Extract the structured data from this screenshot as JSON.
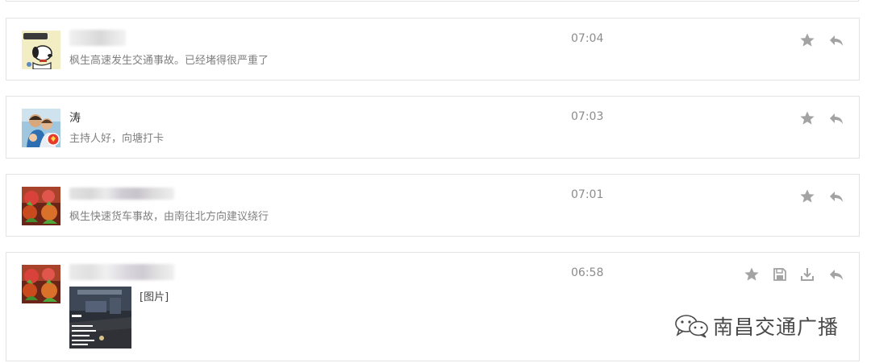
{
  "messages": [
    {
      "name": "",
      "time": "07:04",
      "text": "枫生高速发生交通事故。已经堵得很严重了"
    },
    {
      "name": "涛",
      "time": "07:03",
      "text": "主持人好，向塘打卡"
    },
    {
      "name": "",
      "time": "07:01",
      "text": "枫生快速货车事故，由南往北方向建议绕行"
    },
    {
      "name": "",
      "time": "06:58",
      "image_label": "[图片]"
    }
  ],
  "watermark": {
    "text": "南昌交通广播",
    "icon": "wechat-icon"
  },
  "icons": {
    "star": "star-icon",
    "reply": "reply-icon",
    "save": "save-icon",
    "download": "download-icon"
  },
  "colors": {
    "icon_gray": "#a3a3a3",
    "border": "#e3e3e3"
  }
}
